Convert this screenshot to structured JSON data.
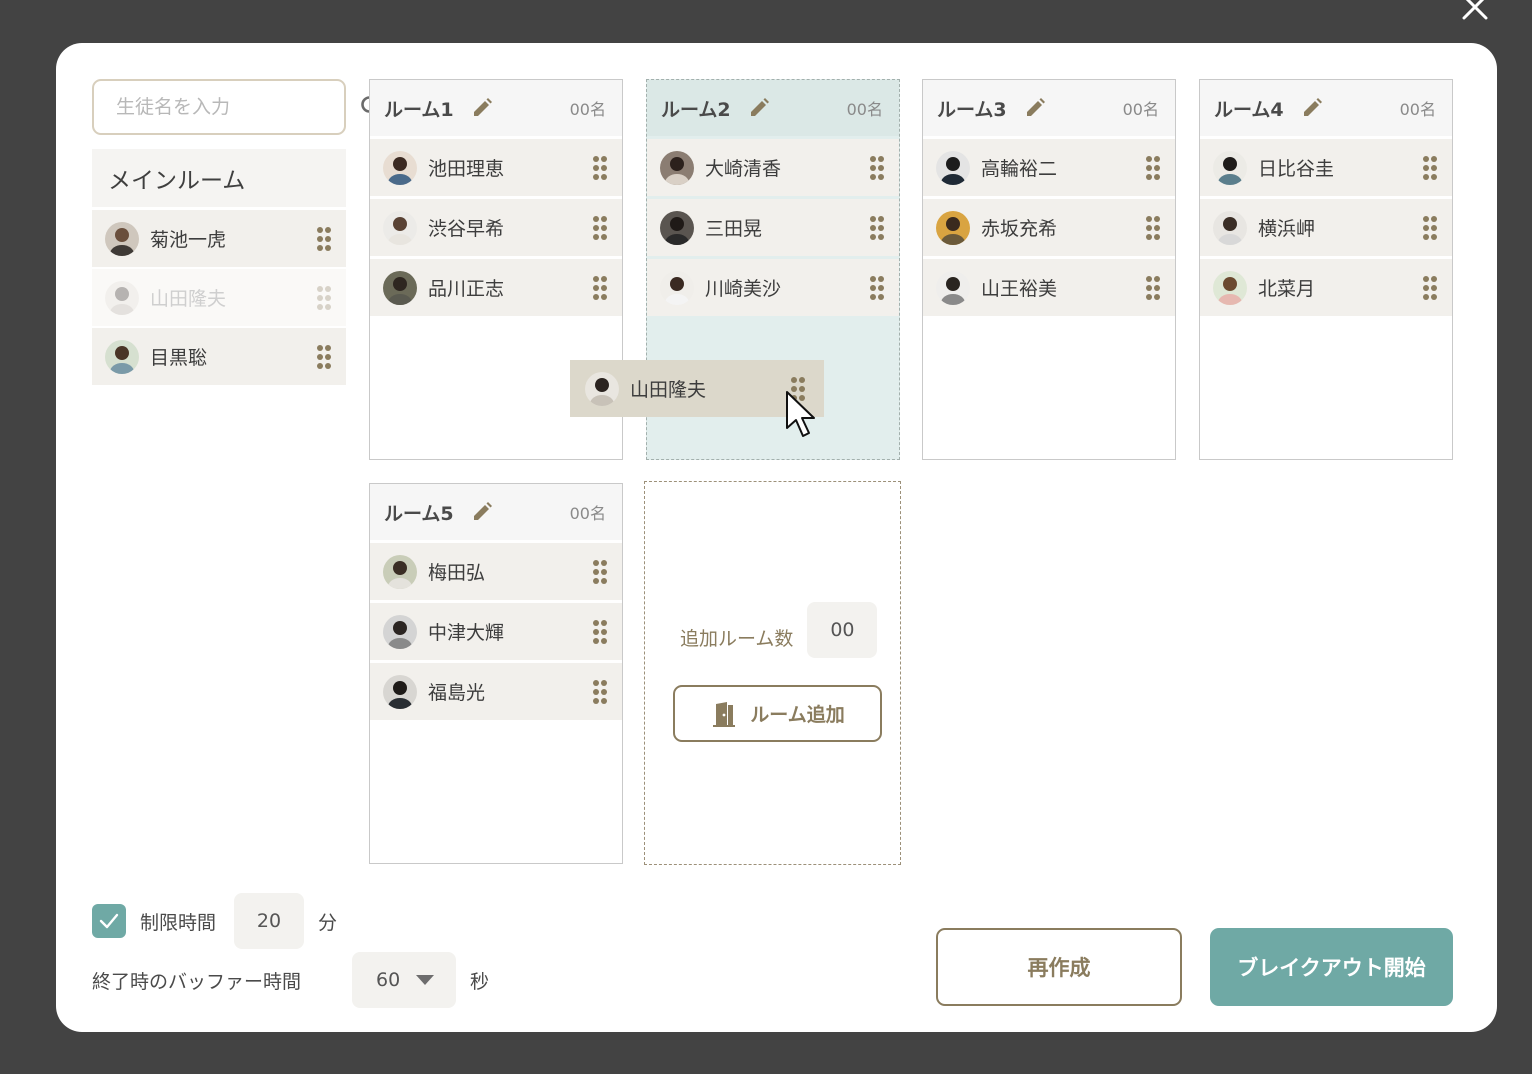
{
  "modal": {
    "close_icon": "close-icon"
  },
  "search": {
    "placeholder": "生徒名を入力",
    "icon": "search-icon"
  },
  "main_room": {
    "title": "メインルーム",
    "members": [
      {
        "name": "菊池一虎",
        "state": "normal"
      },
      {
        "name": "山田隆夫",
        "state": "dragging-ghost"
      },
      {
        "name": "目黒聡",
        "state": "normal"
      }
    ]
  },
  "rooms": [
    {
      "title": "ルーム1",
      "count": "00名",
      "members": [
        "池田理恵",
        "渋谷早希",
        "品川正志"
      ]
    },
    {
      "title": "ルーム2",
      "count": "00名",
      "members": [
        "大崎清香",
        "三田晃",
        "川崎美沙"
      ],
      "active": true
    },
    {
      "title": "ルーム3",
      "count": "00名",
      "members": [
        "高輪裕二",
        "赤坂充希",
        "山王裕美"
      ]
    },
    {
      "title": "ルーム4",
      "count": "00名",
      "members": [
        "日比谷圭",
        "横浜岬",
        "北菜月"
      ]
    },
    {
      "title": "ルーム5",
      "count": "00名",
      "members": [
        "梅田弘",
        "中津大輝",
        "福島光"
      ]
    }
  ],
  "drag_item": {
    "name": "山田隆夫"
  },
  "add_room": {
    "label": "追加ルーム数",
    "value": "00",
    "button_label": "ルーム追加",
    "button_icon": "door-icon"
  },
  "time_limit": {
    "checked": true,
    "label": "制限時間",
    "value": "20",
    "unit": "分"
  },
  "buffer": {
    "label": "終了時のバッファー時間",
    "value": "60",
    "unit": "秒"
  },
  "actions": {
    "recreate_label": "再作成",
    "start_label": "ブレイクアウト開始"
  },
  "colors": {
    "accent_teal": "#6fa9a5",
    "accent_brown": "#8a7c5e",
    "active_room_bg": "#e2eeed"
  }
}
